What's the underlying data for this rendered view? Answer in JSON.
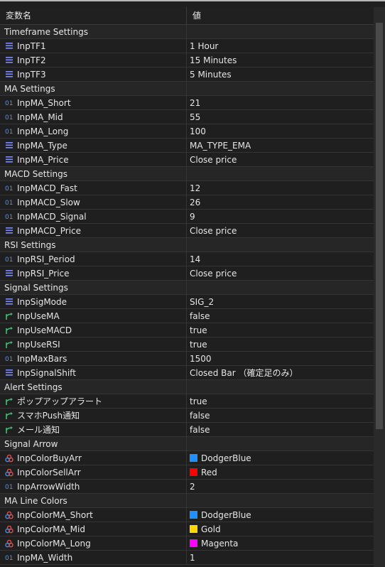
{
  "header": {
    "col_name": "変数名",
    "col_value": "値"
  },
  "rows": [
    {
      "kind": "section",
      "name": "Timeframe Settings"
    },
    {
      "kind": "param",
      "icon": "enum-icon",
      "name": "InpTF1",
      "value": "1 Hour"
    },
    {
      "kind": "param",
      "icon": "enum-icon",
      "name": "InpTF2",
      "value": "15 Minutes"
    },
    {
      "kind": "param",
      "icon": "enum-icon",
      "name": "InpTF3",
      "value": "5 Minutes"
    },
    {
      "kind": "section",
      "name": "MA Settings"
    },
    {
      "kind": "param",
      "icon": "int-icon",
      "name": "InpMA_Short",
      "value": "21"
    },
    {
      "kind": "param",
      "icon": "int-icon",
      "name": "InpMA_Mid",
      "value": "55"
    },
    {
      "kind": "param",
      "icon": "int-icon",
      "name": "InpMA_Long",
      "value": "100"
    },
    {
      "kind": "param",
      "icon": "enum-icon",
      "name": "InpMA_Type",
      "value": "MA_TYPE_EMA"
    },
    {
      "kind": "param",
      "icon": "enum-icon",
      "name": "InpMA_Price",
      "value": "Close price"
    },
    {
      "kind": "section",
      "name": "MACD Settings"
    },
    {
      "kind": "param",
      "icon": "int-icon",
      "name": "InpMACD_Fast",
      "value": "12"
    },
    {
      "kind": "param",
      "icon": "int-icon",
      "name": "InpMACD_Slow",
      "value": "26"
    },
    {
      "kind": "param",
      "icon": "int-icon",
      "name": "InpMACD_Signal",
      "value": "9"
    },
    {
      "kind": "param",
      "icon": "enum-icon",
      "name": "InpMACD_Price",
      "value": "Close price"
    },
    {
      "kind": "section",
      "name": "RSI Settings"
    },
    {
      "kind": "param",
      "icon": "int-icon",
      "name": "InpRSI_Period",
      "value": "14"
    },
    {
      "kind": "param",
      "icon": "enum-icon",
      "name": "InpRSI_Price",
      "value": "Close price"
    },
    {
      "kind": "section",
      "name": "Signal Settings"
    },
    {
      "kind": "param",
      "icon": "enum-icon",
      "name": "InpSigMode",
      "value": "SIG_2"
    },
    {
      "kind": "param",
      "icon": "bool-icon",
      "name": "InpUseMA",
      "value": "false"
    },
    {
      "kind": "param",
      "icon": "bool-icon",
      "name": "InpUseMACD",
      "value": "true"
    },
    {
      "kind": "param",
      "icon": "bool-icon",
      "name": "InpUseRSI",
      "value": "true"
    },
    {
      "kind": "param",
      "icon": "int-icon",
      "name": "InpMaxBars",
      "value": "1500"
    },
    {
      "kind": "param",
      "icon": "enum-icon",
      "name": "InpSignalShift",
      "value": "Closed Bar （確定足のみ）"
    },
    {
      "kind": "section",
      "name": "Alert Settings"
    },
    {
      "kind": "param",
      "icon": "bool-icon",
      "name": "ポップアップアラート",
      "value": "true"
    },
    {
      "kind": "param",
      "icon": "bool-icon",
      "name": "スマホPush通知",
      "value": "false"
    },
    {
      "kind": "param",
      "icon": "bool-icon",
      "name": "メール通知",
      "value": "false"
    },
    {
      "kind": "section",
      "name": "Signal Arrow"
    },
    {
      "kind": "param",
      "icon": "color-icon",
      "name": "InpColorBuyArr",
      "value": "DodgerBlue",
      "swatch": "#1e90ff"
    },
    {
      "kind": "param",
      "icon": "color-icon",
      "name": "InpColorSellArr",
      "value": "Red",
      "swatch": "#ff0000"
    },
    {
      "kind": "param",
      "icon": "int-icon",
      "name": "InpArrowWidth",
      "value": "2"
    },
    {
      "kind": "section",
      "name": "MA Line Colors"
    },
    {
      "kind": "param",
      "icon": "color-icon",
      "name": "InpColorMA_Short",
      "value": "DodgerBlue",
      "swatch": "#1e90ff"
    },
    {
      "kind": "param",
      "icon": "color-icon",
      "name": "InpColorMA_Mid",
      "value": "Gold",
      "swatch": "#ffd700"
    },
    {
      "kind": "param",
      "icon": "color-icon",
      "name": "InpColorMA_Long",
      "value": "Magenta",
      "swatch": "#ff00ff"
    },
    {
      "kind": "param",
      "icon": "int-icon",
      "name": "InpMA_Width",
      "value": "1"
    }
  ],
  "colors": {
    "enum_icon": "#7d8cff",
    "int_icon": "#5b8fe0",
    "bool_icon": "#3fbf6a",
    "color_icon_a": "#e0504a",
    "color_icon_b": "#4a8be0"
  }
}
